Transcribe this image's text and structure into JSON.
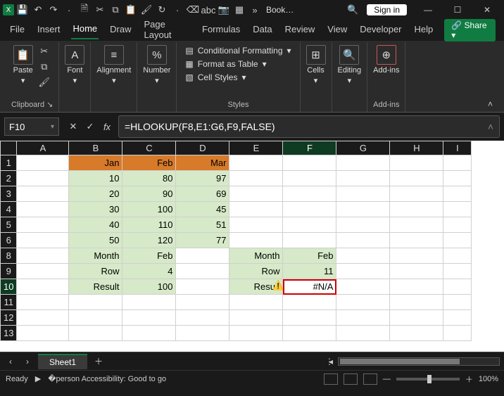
{
  "title": {
    "doc_name": "Book…",
    "signin": "Sign in"
  },
  "menu": {
    "file": "File",
    "insert": "Insert",
    "home": "Home",
    "draw": "Draw",
    "page_layout": "Page Layout",
    "formulas": "Formulas",
    "data": "Data",
    "review": "Review",
    "view": "View",
    "developer": "Developer",
    "help": "Help",
    "share": "Share"
  },
  "ribbon": {
    "clipboard": {
      "paste": "Paste",
      "label": "Clipboard"
    },
    "font": {
      "btn": "Font"
    },
    "align": {
      "btn": "Alignment"
    },
    "number": {
      "btn": "Number"
    },
    "styles": {
      "cond": "Conditional Formatting",
      "table": "Format as Table",
      "cell": "Cell Styles",
      "label": "Styles"
    },
    "cells": {
      "btn": "Cells"
    },
    "editing": {
      "btn": "Editing"
    },
    "addins": {
      "btn": "Add-ins",
      "label": "Add-ins"
    }
  },
  "fbar": {
    "name": "F10",
    "formula": "=HLOOKUP(F8,E1:G6,F9,FALSE)"
  },
  "cols": [
    "A",
    "B",
    "C",
    "D",
    "E",
    "F",
    "G",
    "H",
    "I"
  ],
  "rows": [
    "1",
    "2",
    "3",
    "4",
    "5",
    "6",
    "8",
    "9",
    "10",
    "11",
    "12",
    "13"
  ],
  "cells": {
    "B1": "Jan",
    "C1": "Feb",
    "D1": "Mar",
    "B2": "10",
    "C2": "80",
    "D2": "97",
    "B3": "20",
    "C3": "90",
    "D3": "69",
    "B4": "30",
    "C4": "100",
    "D4": "45",
    "B5": "40",
    "C5": "110",
    "D5": "51",
    "B6": "50",
    "C6": "120",
    "D6": "77",
    "B8": "Month",
    "C8": "Feb",
    "E8": "Month",
    "F8": "Feb",
    "B9": "Row",
    "C9": "4",
    "E9": "Row",
    "F9": "11",
    "B10": "Result",
    "C10": "100",
    "E10": "Result",
    "F10": "#N/A"
  },
  "tabs": {
    "sheet": "Sheet1"
  },
  "status": {
    "ready": "Ready",
    "acc": "Accessibility: Good to go",
    "zoom": "100%"
  }
}
